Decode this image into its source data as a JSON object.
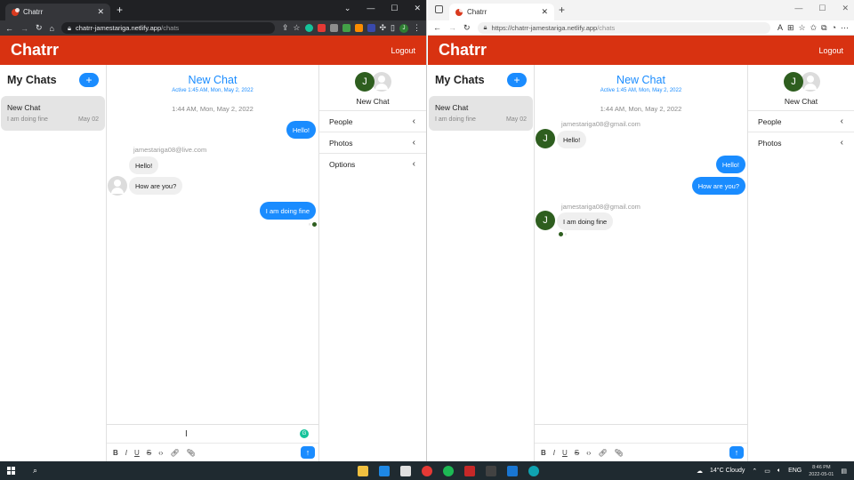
{
  "left_window": {
    "tab_title": "Chatrr",
    "url_host": "chatrr-jamestariga.netlify.app",
    "url_path": "/chats",
    "logout_label": "Logout",
    "brand": "Chatrr",
    "sidebar": {
      "title": "My Chats",
      "add_label": "+",
      "chats": [
        {
          "name": "New Chat",
          "preview": "I am doing fine",
          "date": "May 02"
        }
      ]
    },
    "chat": {
      "title": "New Chat",
      "subtitle": "Active 1:45 AM, Mon, May 2, 2022",
      "timestamp": "1:44 AM, Mon, May 2, 2022",
      "sender": "jamestariga08@live.com",
      "messages": [
        {
          "from": "me",
          "text": "Hello!"
        },
        {
          "from": "them",
          "text": "Hello!"
        },
        {
          "from": "them",
          "text": "How are you?"
        },
        {
          "from": "me",
          "text": "I am doing fine"
        }
      ]
    },
    "info": {
      "avatar_initial": "J",
      "name": "New Chat",
      "sections": [
        "People",
        "Photos",
        "Options"
      ]
    }
  },
  "right_window": {
    "tab_title": "Chatrr",
    "url_host": "https://chatrr-jamestariga.netlify.app",
    "url_path": "/chats",
    "logout_label": "Logout",
    "brand": "Chatrr",
    "sidebar": {
      "title": "My Chats",
      "add_label": "+",
      "chats": [
        {
          "name": "New Chat",
          "preview": "I am doing fine",
          "date": "May 02"
        }
      ]
    },
    "chat": {
      "title": "New Chat",
      "subtitle": "Active 1:45 AM, Mon, May 2, 2022",
      "timestamp": "1:44 AM, Mon, May 2, 2022",
      "sender": "jamestariga08@gmail.com",
      "messages": [
        {
          "from": "them",
          "text": "Hello!"
        },
        {
          "from": "me",
          "text": "Hello!"
        },
        {
          "from": "me",
          "text": "How are you?"
        },
        {
          "from": "them",
          "text": "I am doing fine"
        }
      ],
      "avatar_initial": "J"
    },
    "info": {
      "avatar_initial": "J",
      "name": "New Chat",
      "sections": [
        "People",
        "Photos"
      ]
    }
  },
  "composer_tools": [
    "B",
    "I",
    "U",
    "S",
    "</>",
    "link",
    "attach"
  ],
  "taskbar": {
    "weather": "14°C  Cloudy",
    "lang": "ENG",
    "time": "8:46 PM",
    "date": "2022-05-01"
  },
  "colors": {
    "brand_red": "#d83211",
    "accent_blue": "#1a8cff",
    "avatar_green": "#2e5e1f"
  }
}
